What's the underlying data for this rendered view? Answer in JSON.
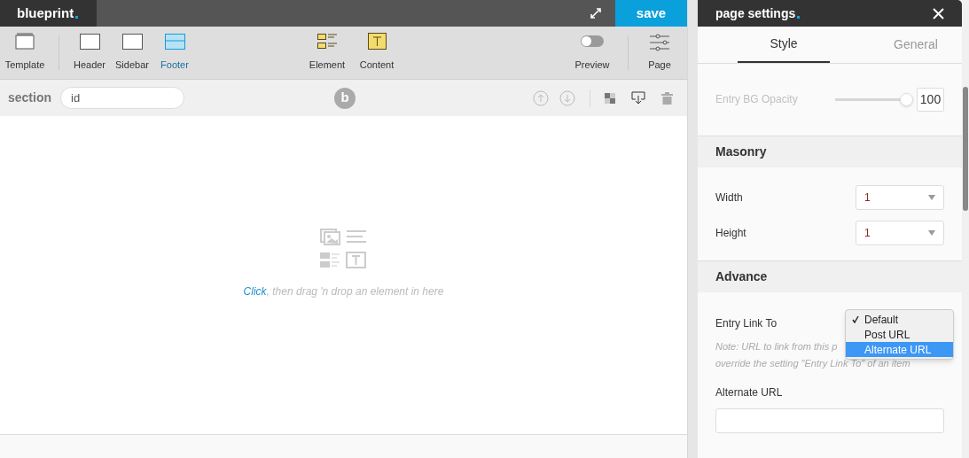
{
  "top_bar": {
    "logo": "blueprint",
    "save": "save"
  },
  "toolbar": {
    "left": [
      {
        "kind": "template",
        "label": "Template",
        "active": false
      },
      {
        "kind": "header",
        "label": "Header",
        "active": false
      },
      {
        "kind": "sidebar",
        "label": "Sidebar",
        "active": false
      },
      {
        "kind": "footer",
        "label": "Footer",
        "active": true
      }
    ],
    "middle": [
      {
        "kind": "element",
        "label": "Element"
      },
      {
        "kind": "content",
        "label": "Content"
      }
    ],
    "preview": {
      "label": "Preview",
      "on": false
    },
    "page": {
      "label": "Page"
    }
  },
  "section_bar": {
    "label": "section",
    "id_placeholder": "id",
    "badge": "b"
  },
  "canvas": {
    "hint_link": "Click",
    "hint_rest": ", then drag 'n drop an element in here"
  },
  "panel": {
    "title": "page settings",
    "tabs": [
      {
        "label": "Style",
        "selected": true
      },
      {
        "label": "General",
        "selected": false
      }
    ],
    "opacity": {
      "label": "Entry BG Opacity",
      "level": 1,
      "value": "100",
      "disabled": true
    },
    "masonry": {
      "title": "Masonry",
      "fields": [
        {
          "label": "Width",
          "value": "1"
        },
        {
          "label": "Height",
          "value": "1"
        }
      ]
    },
    "advance": {
      "title": "Advance",
      "link_label": "Entry Link To",
      "options": [
        {
          "label": "Default",
          "selected": true,
          "highlighted": false
        },
        {
          "label": "Post URL",
          "selected": false,
          "highlighted": false
        },
        {
          "label": "Alternate URL",
          "selected": false,
          "highlighted": true
        }
      ],
      "note_lines": [
        "Note: URL to link from this p",
        "override the setting \"Entry Link To\" of an item"
      ],
      "alt_label": "Alternate URL"
    }
  }
}
